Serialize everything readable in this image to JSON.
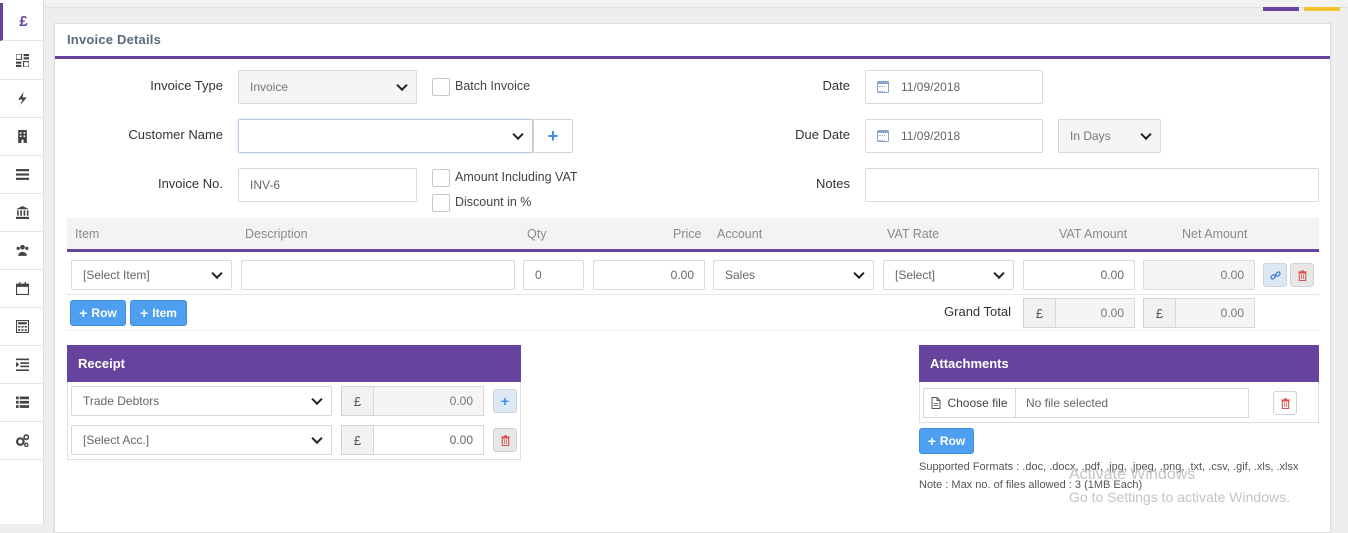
{
  "sidebar": {
    "items": [
      {
        "name": "pound-icon",
        "glyph": "£"
      },
      {
        "name": "dashboard-icon"
      },
      {
        "name": "lightning-icon"
      },
      {
        "name": "building-icon"
      },
      {
        "name": "list-icon"
      },
      {
        "name": "bank-icon"
      },
      {
        "name": "users-icon"
      },
      {
        "name": "calendar-icon"
      },
      {
        "name": "calculator-icon"
      },
      {
        "name": "indent-icon"
      },
      {
        "name": "table-list-icon"
      },
      {
        "name": "cogs-icon"
      }
    ]
  },
  "panel": {
    "title": "Invoice Details"
  },
  "form": {
    "invoice_type_label": "Invoice Type",
    "invoice_type_value": "Invoice",
    "batch_invoice_label": "Batch Invoice",
    "customer_name_label": "Customer Name",
    "customer_name_value": "",
    "add_customer_glyph": "+",
    "invoice_no_label": "Invoice No.",
    "invoice_no_value": "INV-6",
    "amount_incl_vat_label": "Amount Including VAT",
    "discount_pct_label": "Discount in %",
    "date_label": "Date",
    "date_value": "11/09/2018",
    "due_date_label": "Due Date",
    "due_date_value": "11/09/2018",
    "due_in_value": "In Days",
    "notes_label": "Notes",
    "notes_value": ""
  },
  "items_table": {
    "headers": [
      "Item",
      "Description",
      "Qty",
      "Price",
      "Account",
      "VAT Rate",
      "VAT Amount",
      "Net Amount"
    ],
    "row": {
      "item": "[Select Item]",
      "description": "",
      "qty": "0",
      "price": "0.00",
      "account": "Sales",
      "vat_rate": "[Select]",
      "vat_amount": "0.00",
      "net_amount": "0.00"
    },
    "add_row_label": "Row",
    "add_item_label": "Item",
    "grand_total_label": "Grand Total",
    "currency": "£",
    "grand_total_vat": "0.00",
    "grand_total_net": "0.00"
  },
  "receipt": {
    "title": "Receipt",
    "rows": [
      {
        "account": "Trade Debtors",
        "currency": "£",
        "amount": "0.00"
      },
      {
        "account": "[Select Acc.]",
        "currency": "£",
        "amount": "0.00"
      }
    ]
  },
  "attachments": {
    "title": "Attachments",
    "choose_file_label": "Choose file",
    "file_status": "No file selected",
    "add_row_label": "Row",
    "supported_formats": "Supported Formats : .doc, .docx, .pdf, .jpg, .jpeg, .png, .txt, .csv, .gif, .xls, .xlsx",
    "max_files_note": "Note : Max no. of files allowed : 3 (1MB Each)"
  },
  "watermark": {
    "line1": "Activate Windows",
    "line2": "Go to Settings to activate Windows."
  },
  "colors": {
    "accent": "#66439c",
    "button_blue": "#4f9ff0",
    "highlight_yellow": "#f4c430"
  }
}
